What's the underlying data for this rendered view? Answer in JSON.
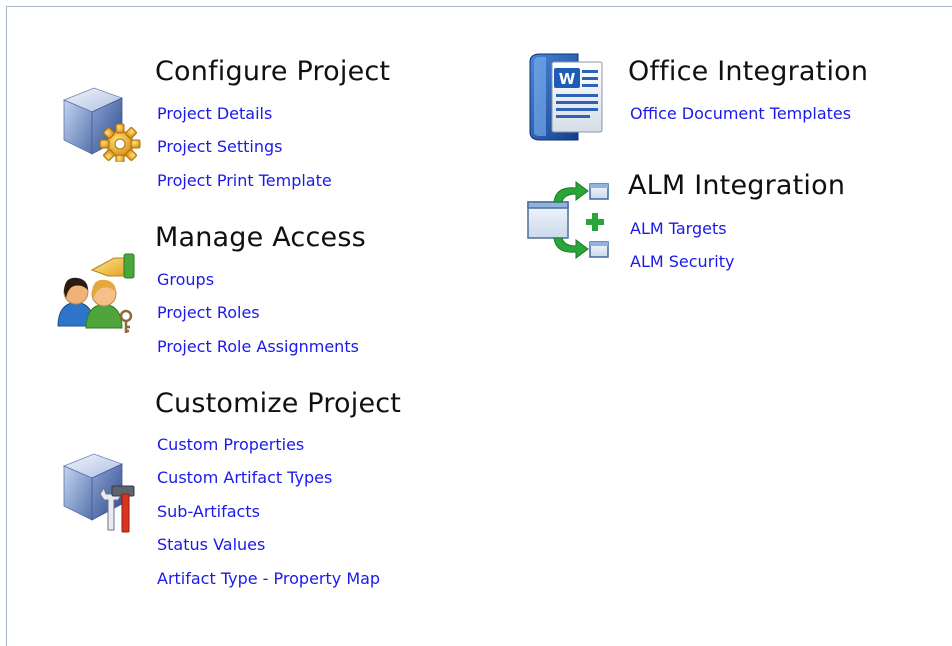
{
  "sections": {
    "configure_project": {
      "title": "Configure Project",
      "icon": "box-gear-icon",
      "links": [
        "Project Details",
        "Project Settings",
        "Project Print Template"
      ]
    },
    "manage_access": {
      "title": "Manage Access",
      "icon": "users-key-icon",
      "links": [
        "Groups",
        "Project Roles",
        "Project Role Assignments"
      ]
    },
    "customize_project": {
      "title": "Customize Project",
      "icon": "box-tools-icon",
      "links": [
        "Custom Properties",
        "Custom Artifact Types",
        "Sub-Artifacts",
        "Status Values",
        "Artifact Type - Property Map"
      ]
    },
    "office_integration": {
      "title": "Office Integration",
      "icon": "word-document-icon",
      "links": [
        "Office Document Templates"
      ]
    },
    "alm_integration": {
      "title": "ALM Integration",
      "icon": "sync-add-icon",
      "links": [
        "ALM Targets",
        "ALM Security"
      ]
    }
  },
  "colors": {
    "link": "#1a1aeb",
    "heading": "#101010",
    "border": "#a9b4c4"
  }
}
